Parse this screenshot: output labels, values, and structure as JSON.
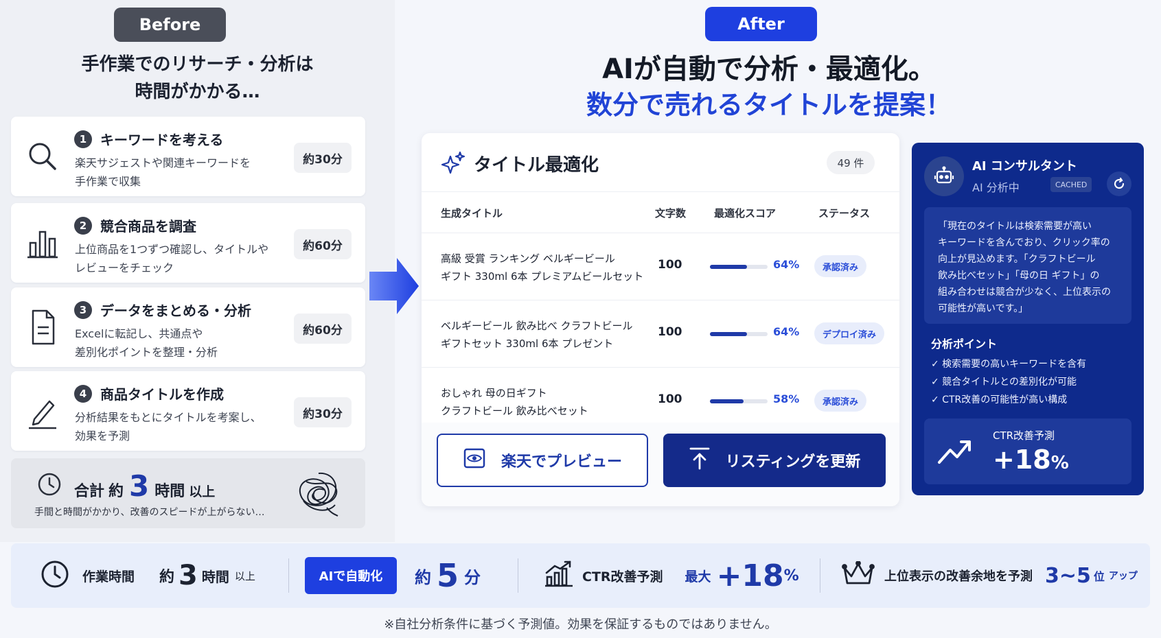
{
  "before": {
    "badge": "Before",
    "heading_line1": "手作業でのリサーチ・分析は",
    "heading_line2": "時間がかかる…",
    "steps": [
      {
        "num": "1",
        "title": "キーワードを考える",
        "desc_line1": "楽天サジェストや関連キーワードを",
        "desc_line2": "手作業で収集",
        "time": "約30分",
        "icon": "search-icon"
      },
      {
        "num": "2",
        "title": "競合商品を調査",
        "desc_line1": "上位商品を1つずつ確認し、タイトルや",
        "desc_line2": "レビューをチェック",
        "time": "約60分",
        "icon": "bar-chart-icon"
      },
      {
        "num": "3",
        "title": "データをまとめる・分析",
        "desc_line1": "Excelに転記し、共通点や",
        "desc_line2": "差別化ポイントを整理・分析",
        "time": "約60分",
        "icon": "document-icon"
      },
      {
        "num": "4",
        "title": "商品タイトルを作成",
        "desc_line1": "分析結果をもとにタイトルを考案し、",
        "desc_line2": "効果を予測",
        "time": "約30分",
        "icon": "pencil-icon"
      }
    ],
    "total": {
      "prefix": "合計",
      "approx": "約",
      "hours": "3",
      "unit": "時間",
      "suffix": "以上",
      "sub": "手間と時間がかかり、改善のスピードが上がらない…"
    }
  },
  "after": {
    "badge": "After",
    "heading_line1": "AIが自動で分析・最適化。",
    "heading_line2": "数分で売れるタイトルを提案！"
  },
  "table": {
    "title": "タイトル最適化",
    "count": "49 件",
    "headers": {
      "title": "生成タイトル",
      "chars": "文字数",
      "score": "最適化スコア",
      "status": "ステータス"
    },
    "rows": [
      {
        "line1": "高級 受賞 ランキング ベルギービール",
        "line2": "ギフト 330ml 6本 プレミアムビールセット",
        "chars": "100",
        "score": 0.64,
        "score_label": "64%",
        "status": "承認済み"
      },
      {
        "line1": "ベルギービール 飲み比べ クラフトビール",
        "line2": "ギフトセット 330ml 6本 プレゼント",
        "chars": "100",
        "score": 0.64,
        "score_label": "64%",
        "status": "デプロイ済み"
      },
      {
        "line1": "おしゃれ 母の日ギフト",
        "line2": "クラフトビール 飲み比べセット",
        "chars": "100",
        "score": 0.58,
        "score_label": "58%",
        "status": "承認済み"
      }
    ],
    "preview_button": "楽天でプレビュー",
    "update_button": "リスティングを更新"
  },
  "consultant": {
    "name": "AI コンサルタント",
    "status": "AI 分析中",
    "cached": "CACHED",
    "quote_lines": [
      "「現在のタイトルは検索需要が高い",
      "キーワードを含んでおり、クリック率の",
      "向上が見込めます。「クラフトビール",
      "飲み比べセット」「母の日 ギフト」の",
      "組み合わせは競合が少なく、上位表示の",
      "可能性が高いです。」"
    ],
    "points_title": "分析ポイント",
    "points": [
      "✓ 検索需要の高いキーワードを含有",
      "✓ 競合タイトルとの差別化が可能",
      "✓ CTR改善の可能性が高い構成"
    ],
    "ctr_label": "CTR改善予測",
    "ctr_value": "+18",
    "ctr_unit": "%"
  },
  "summary": {
    "work_label": "作業時間",
    "work_approx": "約",
    "work_hours": "3",
    "work_unit": "時間",
    "work_suffix": "以上",
    "ai_badge": "AIで自動化",
    "ai_approx": "約",
    "ai_minutes": "5",
    "ai_unit": "分",
    "ctr_label": "CTR改善予測",
    "ctr_prefix": "最大",
    "ctr_value": "+18",
    "ctr_unit": "%",
    "rank_label": "上位表示の改善余地を予測",
    "rank_value": "3~5",
    "rank_unit": "位",
    "rank_suffix": "アップ"
  },
  "disclaimer": "※自社分析条件に基づく予測値。効果を保証するものではありません。",
  "colors": {
    "accent": "#1e3fe0",
    "navy": "#0e2a8c",
    "dark_pill": "#4a4e59"
  }
}
